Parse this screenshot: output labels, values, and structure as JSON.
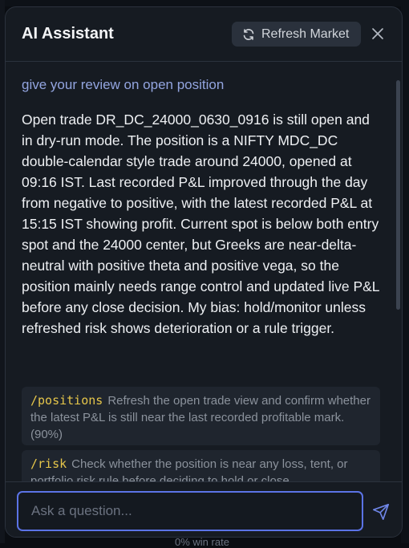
{
  "background": {
    "bottom_text": "0% win rate"
  },
  "header": {
    "title": "AI Assistant",
    "refresh_label": "Refresh Market",
    "refresh_icon": "refresh-icon",
    "close_icon": "close-icon"
  },
  "conversation": {
    "user_question": "give your review on open position",
    "answer": "Open trade DR_DC_24000_0630_0916 is still open and in dry-run mode. The position is a NIFTY MDC_DC double-calendar style trade around 24000, opened at 09:16 IST. Last recorded P&L improved through the day from negative to positive, with the latest recorded P&L at 15:15 IST showing profit. Current spot is below both entry spot and the 24000 center, but Greeks are near-delta-neutral with positive theta and positive vega, so the position mainly needs range control and updated live P&L before any close decision. My bias: hold/monitor unless refreshed risk shows deterioration or a rule trigger.",
    "suggestions": [
      {
        "command": "/positions",
        "text": "Refresh the open trade view and confirm whether the latest P&L is still near the last recorded profitable mark. (90%)"
      },
      {
        "command": "/risk",
        "text": "Check whether the position is near any loss, tent, or portfolio risk rule before deciding to hold or close."
      }
    ]
  },
  "footer": {
    "input_placeholder": "Ask a question...",
    "send_icon": "send-icon"
  },
  "colors": {
    "panel_bg": "#161b22",
    "accent": "#5b73e6",
    "command": "#e6c64a",
    "question": "#93a5e0"
  }
}
